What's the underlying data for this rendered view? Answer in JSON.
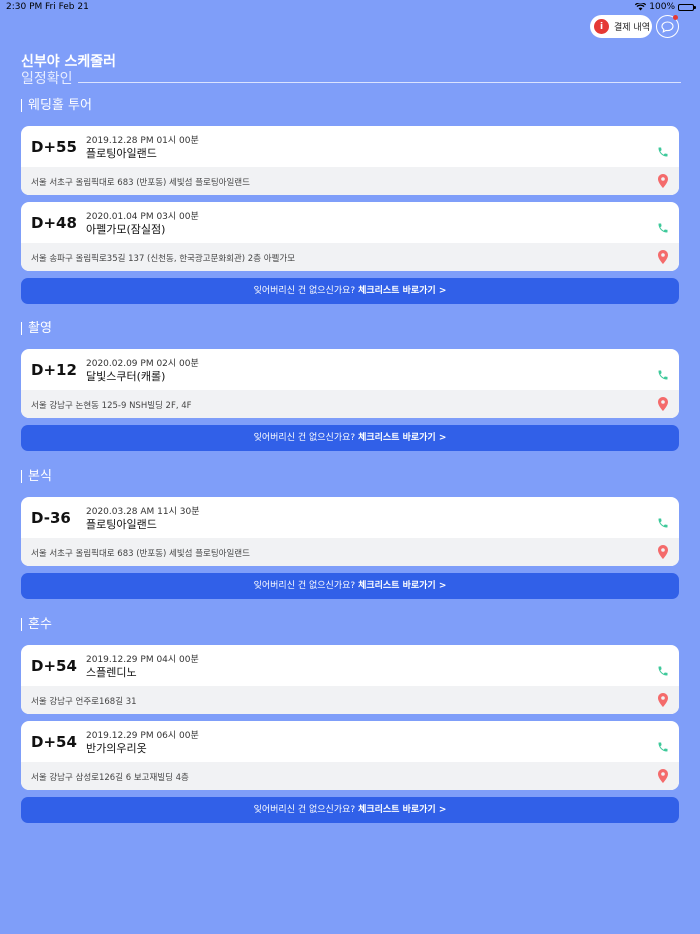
{
  "status_bar": {
    "time": "2:30 PM",
    "date": "Fri Feb 21",
    "battery": "100%"
  },
  "header": {
    "payment_label": "결제 내역",
    "payment_icon_text": "i",
    "title": "신부야 스케줄러",
    "subtitle": "일정확인"
  },
  "checklist": {
    "question": "잊어버리신 건 없으신가요?",
    "link": "체크리스트 바로가기 >"
  },
  "sections": [
    {
      "title": "웨딩홀 투어",
      "cards": [
        {
          "dday": "D+55",
          "datetime": "2019.12.28 PM 01시 00분",
          "name": "플로팅아일랜드",
          "address": "서울 서초구 올림픽대로 683 (반포동) 세빛섬 플로팅아일랜드"
        },
        {
          "dday": "D+48",
          "datetime": "2020.01.04 PM 03시 00분",
          "name": "아펠가모(잠실점)",
          "address": "서울 송파구 올림픽로35길 137 (신천동, 한국광고문화회관) 2층 아펠가모"
        }
      ]
    },
    {
      "title": "촬영",
      "cards": [
        {
          "dday": "D+12",
          "datetime": "2020.02.09 PM 02시 00분",
          "name": "달빛스쿠터(캐롤)",
          "address": "서울 강남구 논현동 125-9 NSH빌딩 2F, 4F"
        }
      ]
    },
    {
      "title": "본식",
      "cards": [
        {
          "dday": "D-36",
          "datetime": "2020.03.28 AM 11시 30분",
          "name": "플로팅아일랜드",
          "address": "서울 서초구 올림픽대로 683 (반포동) 세빛섬 플로팅아일랜드"
        }
      ]
    },
    {
      "title": "혼수",
      "cards": [
        {
          "dday": "D+54",
          "datetime": "2019.12.29 PM 04시 00분",
          "name": "스플렌디노",
          "address": "서울 강남구 언주로168길 31"
        },
        {
          "dday": "D+54",
          "datetime": "2019.12.29 PM 06시 00분",
          "name": "반가의우리옷",
          "address": "서울 강남구 삼성로126길 6 보고재빌딩 4층"
        }
      ]
    }
  ],
  "colors": {
    "background": "#7f9ef9",
    "accent_button": "#3160e8",
    "phone": "#3ec99a",
    "map_pin": "#f46b6b",
    "badge": "#e53935"
  },
  "icons": [
    "wifi-icon",
    "battery-icon",
    "info-icon",
    "chat-icon",
    "phone-icon",
    "map-pin-icon"
  ]
}
